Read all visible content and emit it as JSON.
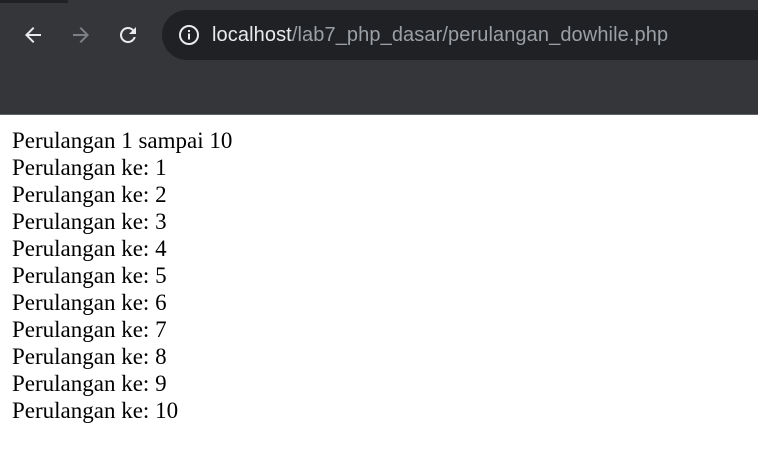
{
  "browser": {
    "url_host": "localhost",
    "url_path": "/lab7_php_dasar/perulangan_dowhile.php"
  },
  "page": {
    "heading": "Perulangan 1 sampai 10",
    "lines": [
      "Perulangan ke: 1",
      "Perulangan ke: 2",
      "Perulangan ke: 3",
      "Perulangan ke: 4",
      "Perulangan ke: 5",
      "Perulangan ke: 6",
      "Perulangan ke: 7",
      "Perulangan ke: 8",
      "Perulangan ke: 9",
      "Perulangan ke: 10"
    ]
  }
}
